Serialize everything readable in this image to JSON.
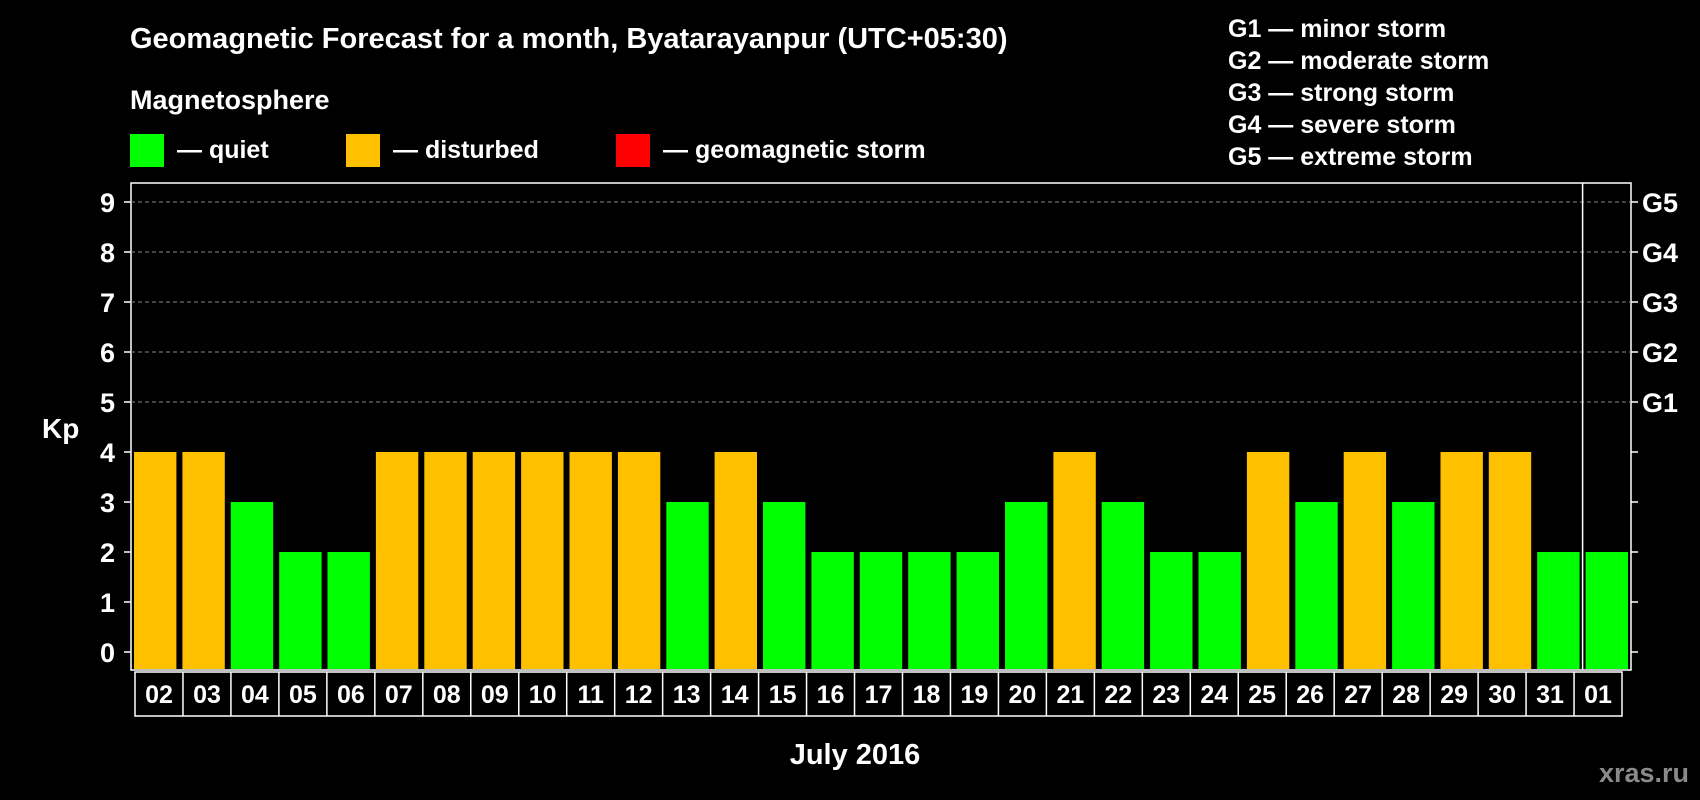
{
  "chart_data": {
    "type": "bar",
    "title": "Geomagnetic Forecast for a month, Byatarayanpur (UTC+05:30)",
    "subtitle": "Magnetosphere",
    "legend": [
      {
        "label": "— quiet",
        "color": "#00ff00"
      },
      {
        "label": "— disturbed",
        "color": "#ffc000"
      },
      {
        "label": "— geomagnetic storm",
        "color": "#ff0000"
      }
    ],
    "storm_scale": [
      "G1 — minor storm",
      "G2 — moderate storm",
      "G3 — strong storm",
      "G4 — severe storm",
      "G5 — extreme storm"
    ],
    "ylabel": "Kp",
    "xlabel": "July 2016",
    "ylim": [
      0,
      9
    ],
    "yticks": [
      0,
      1,
      2,
      3,
      4,
      5,
      6,
      7,
      8,
      9
    ],
    "right_axis_labels": [
      {
        "kp": 5,
        "label": "G1"
      },
      {
        "kp": 6,
        "label": "G2"
      },
      {
        "kp": 7,
        "label": "G3"
      },
      {
        "kp": 8,
        "label": "G4"
      },
      {
        "kp": 9,
        "label": "G5"
      }
    ],
    "grid": "dashed horizontal at Kp 5-9",
    "categories": [
      "02",
      "03",
      "04",
      "05",
      "06",
      "07",
      "08",
      "09",
      "10",
      "11",
      "12",
      "13",
      "14",
      "15",
      "16",
      "17",
      "18",
      "19",
      "20",
      "21",
      "22",
      "23",
      "24",
      "25",
      "26",
      "27",
      "28",
      "29",
      "30",
      "31",
      "01"
    ],
    "values": [
      4,
      4,
      3,
      2,
      2,
      4,
      4,
      4,
      4,
      4,
      4,
      3,
      4,
      3,
      2,
      2,
      2,
      2,
      3,
      4,
      3,
      2,
      2,
      4,
      3,
      4,
      3,
      4,
      4,
      2,
      2
    ],
    "month_divider_after": "31",
    "colors": {
      "quiet": "#00ff00",
      "disturbed": "#ffc000",
      "storm": "#ff0000",
      "background": "#000000",
      "axis": "#ffffff",
      "grid": "#888888"
    }
  },
  "watermark": "xras.ru"
}
